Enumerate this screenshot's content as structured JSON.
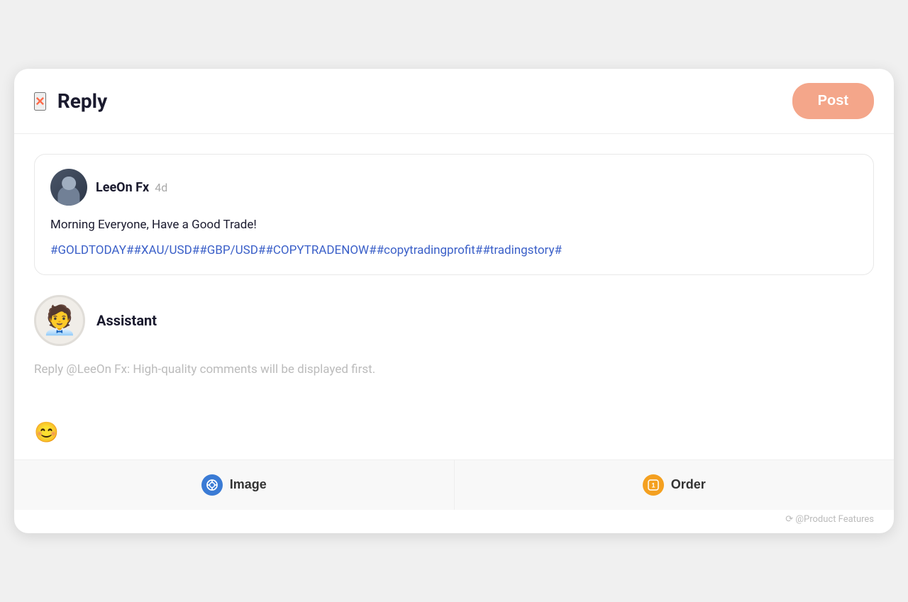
{
  "header": {
    "title": "Reply",
    "close_icon": "×",
    "post_button_label": "Post"
  },
  "original_post": {
    "author_name": "LeeOn Fx",
    "post_time": "4d",
    "post_text": "Morning Everyone, Have a Good Trade!",
    "post_hashtags": "#GOLDTODAY##XAU/USD##GBP/USD##COPYTRADENOW##copytradingprofit##tradingstory#"
  },
  "reply": {
    "author_name": "Assistant",
    "input_placeholder": "Reply @LeeOn Fx: High-quality comments will be displayed first.",
    "emoji_icon": "😊"
  },
  "toolbar": {
    "image_button_label": "Image",
    "order_button_label": "Order"
  },
  "watermark": "⟳ @Product Features"
}
